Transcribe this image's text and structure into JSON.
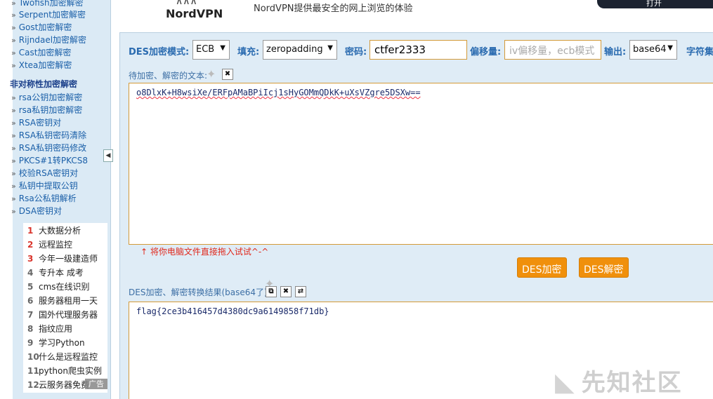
{
  "sidebar": {
    "items_top": [
      "Twofish加密解密",
      "Serpent加密解密",
      "Gost加密解密",
      "Rijndael加密解密",
      "Cast加密解密",
      "Xtea加密解密"
    ],
    "section_title": "非对称性加密解密",
    "items_asym": [
      "rsa公钥加密解密",
      "rsa私钥加密解密",
      "RSA密钥对",
      "RSA私钥密码清除",
      "RSA私钥密码修改",
      "PKCS#1转PKCS8",
      "校验RSA密钥对",
      "私钥中提取公钥",
      "Rsa公私钥解析",
      "DSA密钥对"
    ],
    "collapse_glyph": "◀"
  },
  "ads": {
    "items": [
      {
        "num": "1",
        "label": "大数据分析"
      },
      {
        "num": "2",
        "label": "远程监控"
      },
      {
        "num": "3",
        "label": "今年一级建造师"
      },
      {
        "num": "4",
        "label": "专升本 成考"
      },
      {
        "num": "5",
        "label": "cms在线识别"
      },
      {
        "num": "6",
        "label": "服务器租用一天"
      },
      {
        "num": "7",
        "label": "国外代理服务器"
      },
      {
        "num": "8",
        "label": "指纹应用"
      },
      {
        "num": "9",
        "label": "学习Python"
      },
      {
        "num": "10",
        "label": "什么是远程监控"
      },
      {
        "num": "11",
        "label": "python爬虫实例"
      },
      {
        "num": "12",
        "label": "云服务器免费"
      }
    ],
    "tag": "广告"
  },
  "banner": {
    "brand": "NordVPN",
    "slogan": "NordVPN提供最安全的网上浏览的体验",
    "cta": "打开"
  },
  "toolbar": {
    "mode_label": "DES加密模式:",
    "mode_value": "ECB",
    "padding_label": "填充:",
    "padding_value": "zeropadding",
    "password_label": "密码:",
    "password_value": "ctfer2333",
    "offset_label": "偏移量:",
    "offset_placeholder": "iv偏移量，ecb模式",
    "output_label": "输出:",
    "output_value": "base64",
    "charset_label": "字符集"
  },
  "input_section": {
    "label": "待加密、解密的文本:",
    "text": "o8DlxK+H8wsiXe/ERFpAMaBPiIcj1sHyGOMmQDkK+uXsVZgre5DSXw==",
    "drag_hint": "↑ 将你电脑文件直接拖入试试^-^"
  },
  "actions": {
    "encrypt": "DES加密",
    "decrypt": "DES解密"
  },
  "output_section": {
    "label": "DES加密、解密转换结果(base64了):",
    "text": "flag{2ce3b416457d4380dc9a6149858f71db}"
  },
  "watermark": "先知社区"
}
